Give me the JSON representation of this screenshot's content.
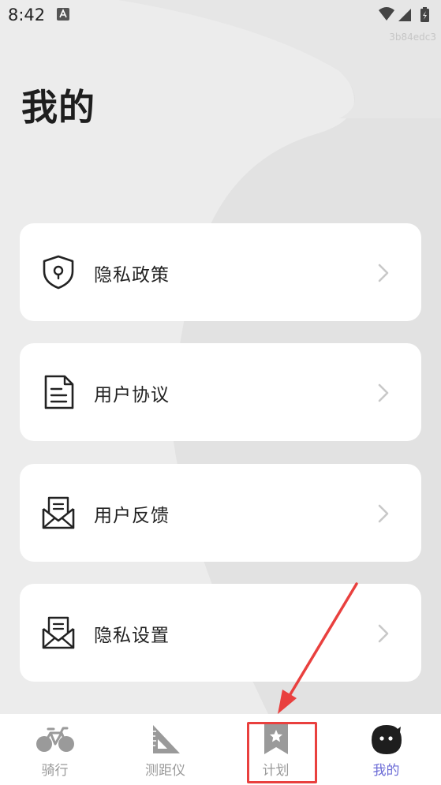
{
  "status_bar": {
    "time": "8:42",
    "build_id": "3b84edc3"
  },
  "page": {
    "title": "我的"
  },
  "menu": [
    {
      "label": "隐私政策",
      "icon": "shield-lock-icon"
    },
    {
      "label": "用户协议",
      "icon": "document-icon"
    },
    {
      "label": "用户反馈",
      "icon": "mail-feedback-icon"
    },
    {
      "label": "隐私设置",
      "icon": "mail-settings-icon"
    }
  ],
  "tabs": [
    {
      "label": "骑行",
      "icon": "bicycle-icon",
      "active": false
    },
    {
      "label": "测距仪",
      "icon": "ruler-triangle-icon",
      "active": false
    },
    {
      "label": "计划",
      "icon": "bookmark-star-icon",
      "active": false
    },
    {
      "label": "我的",
      "icon": "profile-face-icon",
      "active": true
    }
  ],
  "colors": {
    "background": "#ececec",
    "card": "#ffffff",
    "tab_active": "#6b6bd6",
    "tab_inactive": "#9a9a9a",
    "annotation": "#e9403e"
  }
}
